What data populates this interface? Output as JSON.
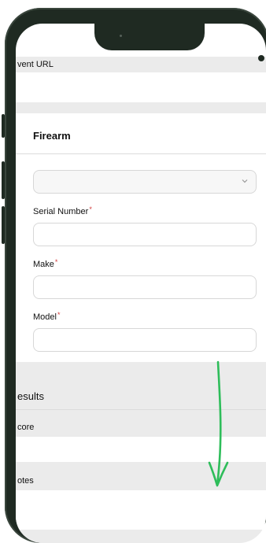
{
  "form": {
    "event_url_label": "vent URL",
    "firearm_title": "Firearm",
    "firearm_select_value": "",
    "serial_number_label": "Serial Number",
    "make_label": "Make",
    "model_label": "Model",
    "required_mark": "*",
    "results_title": "esults",
    "score_label": "core",
    "notes_label": "otes"
  },
  "colors": {
    "phone_frame": "#1f2a22",
    "section_band": "#ebebeb",
    "required_asterisk": "#d23b3b",
    "annotation_arrow": "#2ebd5a"
  },
  "icons": {
    "select_chevron": "chevron-down-icon",
    "annotation": "scroll-down-arrow-icon"
  }
}
